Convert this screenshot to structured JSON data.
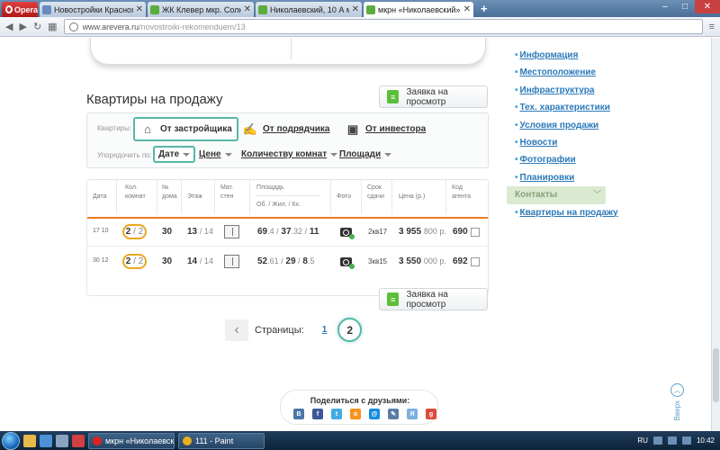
{
  "browser": {
    "menu_label": "Opera",
    "tabs": [
      {
        "title": "Новостройки Красноярс…",
        "favicon_color": "#6a8ac0",
        "active": false
      },
      {
        "title": "ЖК Клевер мкр. Солнеч…",
        "favicon_color": "#5cae3c",
        "active": false
      },
      {
        "title": "Николаевский, 10 А мкр…",
        "favicon_color": "#5cae3c",
        "active": false
      },
      {
        "title": "мкрн «Николаевский», д…",
        "favicon_color": "#5cae3c",
        "active": true
      }
    ],
    "new_tab_label": "+",
    "url_host": "www.arevera.ru",
    "url_path": "/novostroiki-rekomenduem/13"
  },
  "sidebar": {
    "items": [
      {
        "label": "Информация",
        "active": false
      },
      {
        "label": "Местоположение",
        "active": false
      },
      {
        "label": "Инфраструктура",
        "active": false
      },
      {
        "label": "Тех. характеристики",
        "active": false
      },
      {
        "label": "Условия продажи",
        "active": false
      },
      {
        "label": "Новости",
        "active": false
      },
      {
        "label": "Фотографии",
        "active": false
      },
      {
        "label": "Планировки",
        "active": false
      },
      {
        "label": "Контакты",
        "active": true
      },
      {
        "label": "Квартиры на продажу",
        "active": false
      }
    ]
  },
  "section": {
    "title": "Квартиры на продажу",
    "view_request_label": "Заявка на просмотр"
  },
  "filter": {
    "sources_label": "Квартиры:",
    "sources": [
      {
        "label": "От застройщика",
        "active": true
      },
      {
        "label": "От подрядчика",
        "active": false
      },
      {
        "label": "От инвестора",
        "active": false
      }
    ],
    "sort_label": "Упорядочить по:",
    "sort_options": [
      {
        "label": "Дате",
        "active": true
      },
      {
        "label": "Цене",
        "active": false
      },
      {
        "label": "Количеству комнат",
        "active": false
      },
      {
        "label": "Площади",
        "active": false
      }
    ]
  },
  "table": {
    "headers": {
      "date": "Дата",
      "rooms": "Кол. комнат",
      "house": "№ дома",
      "floor": "Этаж",
      "material": "Мат. стен",
      "area": "Площадь",
      "area_sub": "Об. / Жил. / Кх.",
      "photo": "Фото",
      "deadline": "Срок сдачи",
      "price": "Цена (р.)",
      "agent": "Код агента"
    },
    "rows": [
      {
        "date": "17 10",
        "rooms": "2",
        "rooms_total": "/ 2",
        "house": "30",
        "floor": "13",
        "floor_total": "/ 14",
        "area_total": "69",
        "area_total_dec": ".4 /",
        "area_live": "37",
        "area_live_dec": ".32 /",
        "area_kitchen": "11",
        "deadline": "2кв17",
        "price_main": "3 955",
        "price_rest": "800 р.",
        "agent": "690"
      },
      {
        "date": "30 12",
        "rooms": "2",
        "rooms_total": "/ 2",
        "house": "30",
        "floor": "14",
        "floor_total": "/ 14",
        "area_total": "52",
        "area_total_dec": ".61 /",
        "area_live": "29",
        "area_live_dec": " /",
        "area_kitchen": "8",
        "area_kitchen_dec": ".5",
        "deadline": "3кв15",
        "price_main": "3 550",
        "price_rest": "000 р.",
        "agent": "692"
      }
    ]
  },
  "pager": {
    "label": "Страницы:",
    "page1": "1",
    "page2": "2"
  },
  "share": {
    "title": "Поделиться с друзьями:",
    "icons": [
      {
        "name": "vk-icon",
        "glyph": "В",
        "color": "#4a76a8"
      },
      {
        "name": "facebook-icon",
        "glyph": "f",
        "color": "#3b5998"
      },
      {
        "name": "twitter-icon",
        "glyph": "t",
        "color": "#41abe1"
      },
      {
        "name": "odnoklassniki-icon",
        "glyph": "о",
        "color": "#f4931e"
      },
      {
        "name": "mailru-icon",
        "glyph": "@",
        "color": "#168de2"
      },
      {
        "name": "livejournal-icon",
        "glyph": "✎",
        "color": "#5a7fa6"
      },
      {
        "name": "yandex-icon",
        "glyph": "Я",
        "color": "#7ab0e0"
      },
      {
        "name": "googleplus-icon",
        "glyph": "g",
        "color": "#dd4b39"
      }
    ]
  },
  "scroll_up": {
    "label": "Вверх"
  },
  "taskbar": {
    "tasks": [
      {
        "label": "мкрн «Николаевск…",
        "icon_color": "#d22"
      },
      {
        "label": "111 - Paint",
        "icon_color": "#e8b020"
      }
    ],
    "lang": "RU",
    "clock": "10:42"
  }
}
